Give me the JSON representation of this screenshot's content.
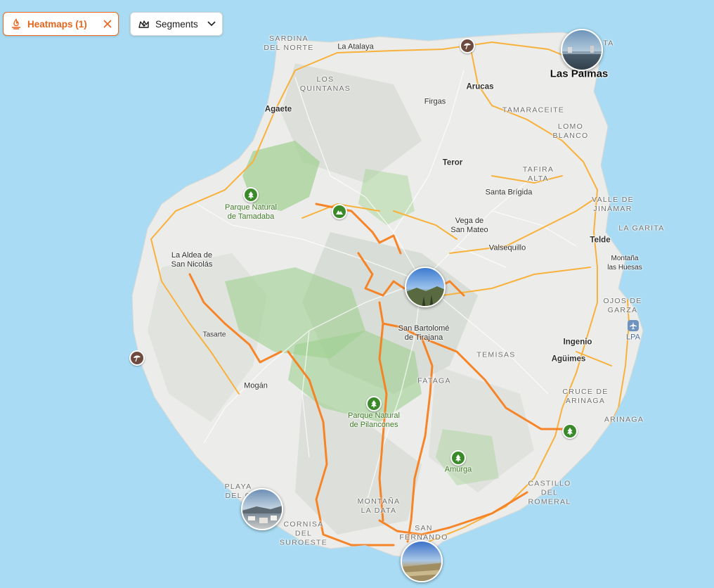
{
  "controls": {
    "heatmaps_label": "Heatmaps (1)",
    "segments_label": "Segments"
  },
  "colors": {
    "sea": "#a9dcf4",
    "land": "#ececea",
    "forest": "#9fd08f",
    "heatmap": "#f7801f",
    "road": "#f8b13a",
    "accent": "#f26a1b",
    "park_icon": "#3b8a2a",
    "beach_icon": "#6e4b3f"
  },
  "map": {
    "cities": [
      {
        "name": "Las Palmas"
      }
    ],
    "towns": [
      {
        "name": "La Atalaya"
      },
      {
        "name": "Agaete"
      },
      {
        "name": "Arucas"
      },
      {
        "name": "Firgas"
      },
      {
        "name": "Teror"
      },
      {
        "name": "Santa Brígida"
      },
      {
        "name": "Vega de\nSan Mateo"
      },
      {
        "name": "Valsequillo"
      },
      {
        "name": "Telde"
      },
      {
        "name": "Montaña\nlas Huesas"
      },
      {
        "name": "La Aldea de\nSan Nicolás"
      },
      {
        "name": "Tasarte"
      },
      {
        "name": "San Bartolomé\nde Tirajana"
      },
      {
        "name": "Ingenio"
      },
      {
        "name": "Agüimes"
      },
      {
        "name": "Mogán"
      },
      {
        "name": "LPA"
      }
    ],
    "areas": [
      {
        "name": "SARDINA\nDEL NORTE"
      },
      {
        "name": "LOS\nQUINTANAS"
      },
      {
        "name": "TAMARACEITE"
      },
      {
        "name": "LOMO\nBLANCO"
      },
      {
        "name": "TAFIRA\nALTA"
      },
      {
        "name": "VALLE DE\nJINÁMAR"
      },
      {
        "name": "LA GARITA"
      },
      {
        "name": "OJOS DE\nGARZA"
      },
      {
        "name": "TEMISAS"
      },
      {
        "name": "FATAGA"
      },
      {
        "name": "CRUCE DE\nARINAGA"
      },
      {
        "name": "ARINAGA"
      },
      {
        "name": "CASTILLO\nDEL\nROMERAL"
      },
      {
        "name": "MONTAÑA\nLA DATA"
      },
      {
        "name": "SAN\nFERNANDO"
      },
      {
        "name": "CORNISA\nDEL\nSUROESTE"
      },
      {
        "name": "PLAYA\nDEL C"
      },
      {
        "name": "TA"
      }
    ],
    "parks": [
      {
        "name": "Parque Natural\nde Tamadaba"
      },
      {
        "name": "Parque Natural\nde Pilancones"
      },
      {
        "name": "Amurga"
      }
    ],
    "photos": [
      {
        "name": "photo-las-palmas"
      },
      {
        "name": "photo-center"
      },
      {
        "name": "photo-playa-del-cura"
      },
      {
        "name": "photo-maspalomas"
      }
    ],
    "pois": [
      {
        "icon": "beach-icon"
      },
      {
        "icon": "beach-icon"
      },
      {
        "icon": "mountain-icon"
      },
      {
        "icon": "tree-icon"
      },
      {
        "icon": "tree-icon"
      },
      {
        "icon": "tree-icon"
      },
      {
        "icon": "tree-icon"
      },
      {
        "icon": "airport-icon"
      }
    ]
  }
}
